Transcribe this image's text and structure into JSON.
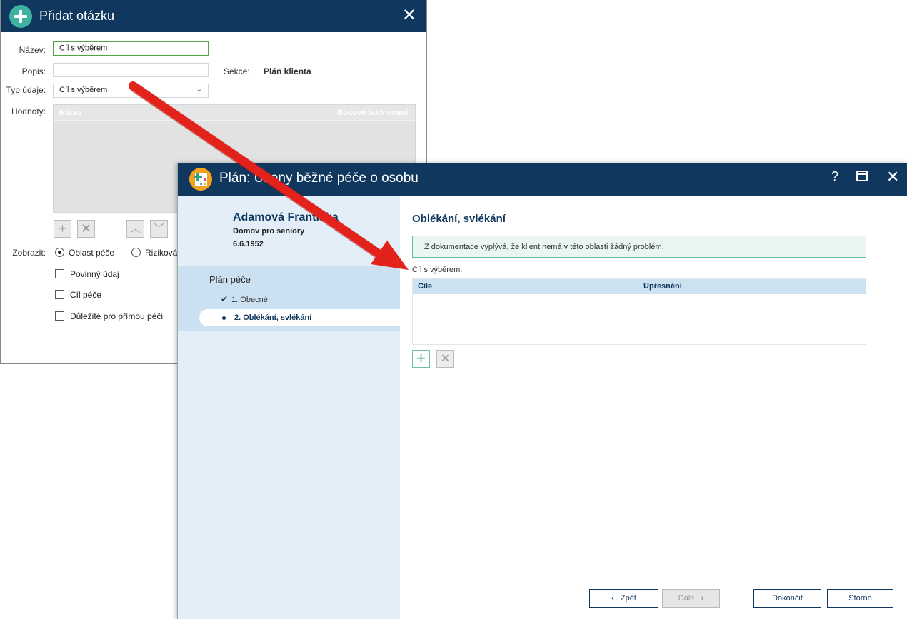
{
  "dialog": {
    "title": "Přidat otázku",
    "fields": {
      "nazev_label": "Název:",
      "nazev_value": "Cíl s výběrem",
      "popis_label": "Popis:",
      "popis_value": "",
      "sekce_label": "Sekce:",
      "sekce_value": "Plán klienta",
      "typ_label": "Typ údaje:",
      "typ_value": "Cíl s výběrem",
      "hodnoty_label": "Hodnoty:"
    },
    "grid": {
      "col_name": "Název",
      "col_score": "Bodové hodnocení"
    },
    "zobrazit_label": "Zobrazit:",
    "radio_options": [
      "Oblast péče",
      "Riziková"
    ],
    "radio_selected": "Oblast péče",
    "checkboxes": [
      "Povinný údaj",
      "Cíl péče",
      "Důležité pro přímou péči"
    ]
  },
  "window": {
    "title": "Plán: Úkony běžné péče o osobu",
    "help_glyph": "?",
    "patient": {
      "name": "Adamová Františka",
      "facility": "Domov pro seniory",
      "birthdate": "6.6.1952"
    },
    "plan": {
      "heading": "Plán péče",
      "steps": [
        {
          "label": "1. Obecné",
          "state": "done"
        },
        {
          "label": "2. Oblékání, svlékání",
          "state": "current"
        }
      ]
    },
    "section": {
      "title": "Oblékání, svlékání",
      "info": "Z dokumentace vyplývá, že klient nemá v této oblasti žádný problém.",
      "table_label": "Cíl s výběrem:",
      "table_columns": [
        "Cíle",
        "Upřesnění"
      ],
      "rows": []
    },
    "buttons": {
      "back": "Zpět",
      "next": "Dále",
      "finish": "Dokončit",
      "cancel": "Storno"
    }
  },
  "colors": {
    "titlebar": "#10375e",
    "accent": "#2ea38a",
    "arrow": "#e3231b"
  }
}
